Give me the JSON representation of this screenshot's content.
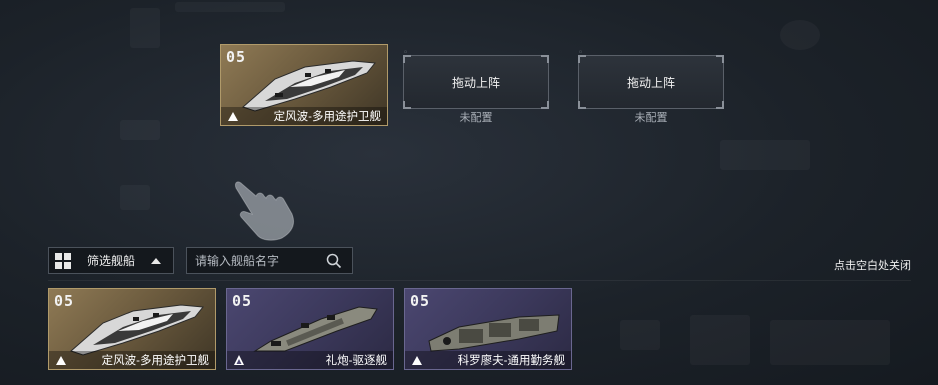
{
  "formation": {
    "filled_slot": {
      "level": "05",
      "name": "定风波-多用途护卫舰",
      "rarity": "gold"
    },
    "empty_slots": [
      {
        "action": "拖动上阵",
        "status": "未配置"
      },
      {
        "action": "拖动上阵",
        "status": "未配置"
      }
    ]
  },
  "filter": {
    "label": "筛选舰船",
    "icon": "grid-icon"
  },
  "search": {
    "placeholder": "请输入舰船名字",
    "icon": "search-icon"
  },
  "close_hint": "点击空白处关闭",
  "ship_list": [
    {
      "level": "05",
      "name": "定风波-多用途护卫舰",
      "rarity": "gold"
    },
    {
      "level": "05",
      "name": "礼炮-驱逐舰",
      "rarity": "purple"
    },
    {
      "level": "05",
      "name": "科罗廖夫-通用勤务舰",
      "rarity": "purple"
    }
  ],
  "colors": {
    "gold_card": "#8f7a55",
    "purple_card": "#4b4770",
    "background": "#1c2229"
  }
}
